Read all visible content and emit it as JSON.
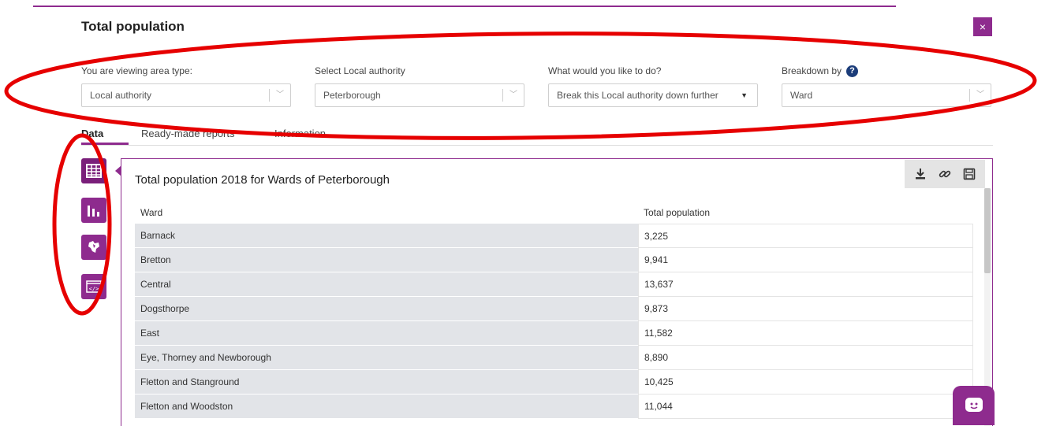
{
  "dialog": {
    "title": "Total population",
    "close_label": "×"
  },
  "filters": [
    {
      "label": "You are viewing area type:",
      "value": "Local authority"
    },
    {
      "label": "Select Local authority",
      "value": "Peterborough"
    },
    {
      "label": "What would you like to do?",
      "value": "Break this Local authority down further"
    },
    {
      "label": "Breakdown by",
      "value": "Ward",
      "help": "?"
    }
  ],
  "tabs": [
    "Data",
    "Ready-made reports",
    "Information"
  ],
  "active_tab": "Data",
  "side_icons": [
    "table-icon",
    "bar-chart-icon",
    "map-icon",
    "embed-icon"
  ],
  "panel": {
    "title": "Total population 2018 for Wards of Peterborough",
    "columns": [
      "Ward",
      "Total population"
    ],
    "rows": [
      [
        "Barnack",
        "3,225"
      ],
      [
        "Bretton",
        "9,941"
      ],
      [
        "Central",
        "13,637"
      ],
      [
        "Dogsthorpe",
        "9,873"
      ],
      [
        "East",
        "11,582"
      ],
      [
        "Eye, Thorney and Newborough",
        "8,890"
      ],
      [
        "Fletton and Stanground",
        "10,425"
      ],
      [
        "Fletton and Woodston",
        "11,044"
      ]
    ]
  },
  "colors": {
    "accent": "#8e2b8e",
    "annotation": "#e60000",
    "help": "#1c3d7a"
  }
}
